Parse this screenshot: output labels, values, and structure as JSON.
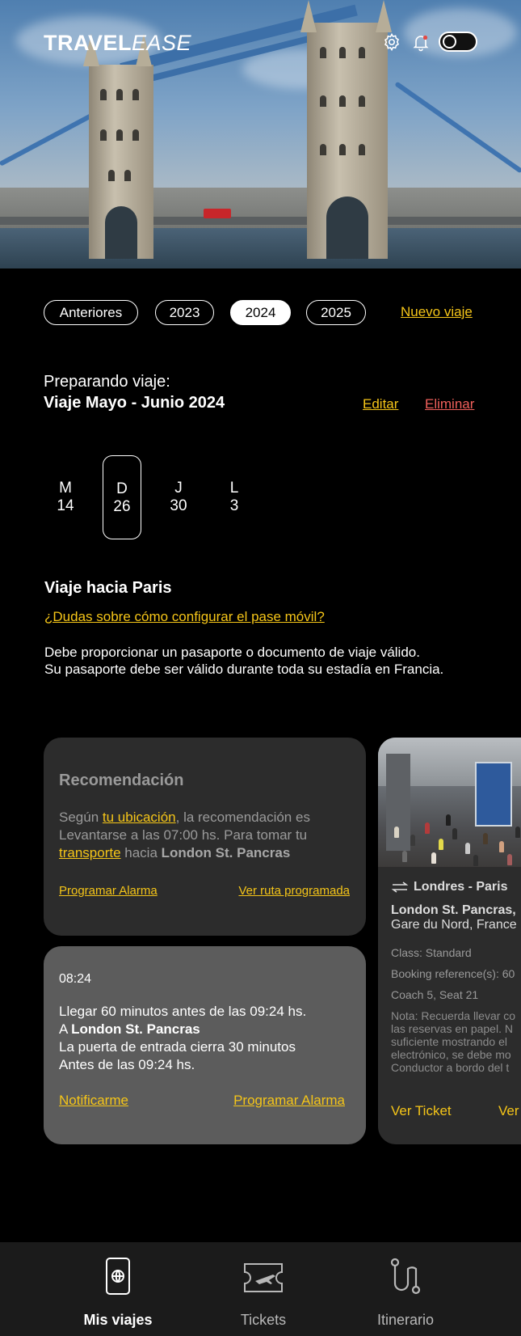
{
  "header": {
    "logo_bold": "TRAVEL",
    "logo_italic": "EASE",
    "icons": [
      "gear-icon",
      "bell-icon",
      "theme-toggle"
    ]
  },
  "years": {
    "items": [
      "Anteriores",
      "2023",
      "2024",
      "2025"
    ],
    "selected": "2024",
    "new_trip": "Nuevo viaje"
  },
  "trip": {
    "status_label": "Preparando viaje:",
    "name": "Viaje Mayo - Junio 2024",
    "edit": "Editar",
    "delete": "Eliminar"
  },
  "days": [
    {
      "weekday": "M",
      "date": "14"
    },
    {
      "weekday": "D",
      "date": "26",
      "selected": true
    },
    {
      "weekday": "J",
      "date": "30"
    },
    {
      "weekday": "L",
      "date": "3"
    }
  ],
  "destination": {
    "title": "Viaje hacia Paris",
    "help_link": "¿Dudas sobre cómo configurar el pase móvil?",
    "notice_line1": "Debe proporcionar un pasaporte o documento de viaje válido.",
    "notice_line2": "Su pasaporte debe ser válido durante toda su estadía en Francia."
  },
  "recommendation": {
    "title": "Recomendación",
    "text_1": "Según ",
    "link_location": "tu ubicación",
    "text_2": ", la recomendación es Levantarse a las 07:00 hs. Para tomar tu ",
    "link_transport": "transporte",
    "text_3": " hacia ",
    "station": "London St. Pancras",
    "action_alarm": "Programar Alarma",
    "action_route": "Ver ruta programada"
  },
  "reminder": {
    "time": "08:24",
    "line1": "Llegar 60 minutos antes de las 09:24 hs.",
    "line2_prefix": "A ",
    "line2_station": "London St. Pancras",
    "line3": "La puerta de entrada cierra 30 minutos",
    "line4": "Antes de las 09:24 hs.",
    "action_notify": "Notificarme",
    "action_alarm": "Programar Alarma"
  },
  "ticket": {
    "route": "Londres - Paris",
    "from": "London St. Pancras,",
    "to": "Gare du Nord, France",
    "class": "Class: Standard",
    "booking": "Booking reference(s): 60",
    "seat": "Coach 5, Seat 21",
    "note": "Nota: Recuerda llevar co\nlas reservas en papel. N\nsuficiente mostrando el\nelectrónico, se debe mo\nConductor a bordo del t",
    "action_ticket": "Ver Ticket",
    "action_more": "Ver"
  },
  "nav": {
    "items": [
      {
        "label": "Mis viajes",
        "icon": "passport-icon",
        "active": true
      },
      {
        "label": "Tickets",
        "icon": "ticket-icon"
      },
      {
        "label": "Itinerario",
        "icon": "route-icon"
      }
    ]
  },
  "colors": {
    "accent": "#f5c518",
    "danger": "#f0605b",
    "background": "#000000",
    "card_dark": "#2c2c2c",
    "card_light": "#5c5c5c"
  }
}
